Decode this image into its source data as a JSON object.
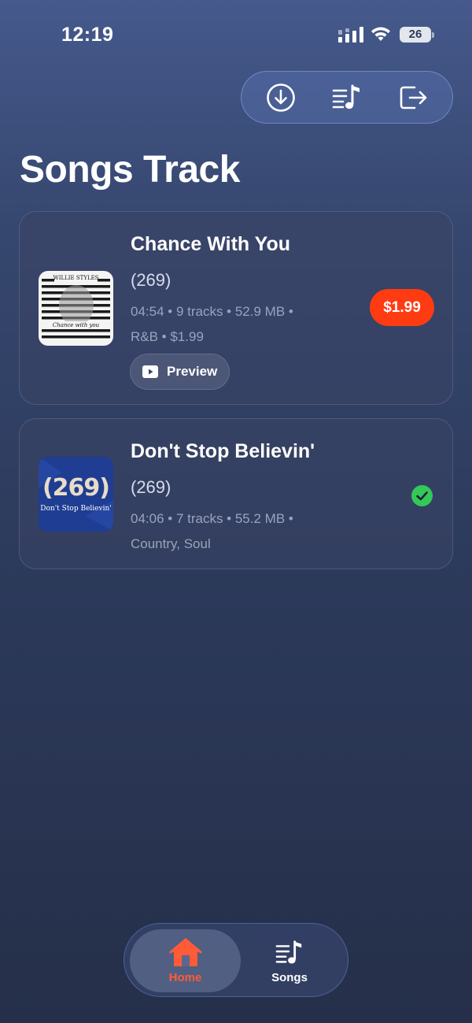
{
  "status_bar": {
    "time": "12:19",
    "battery": "26"
  },
  "top_actions": [
    {
      "icon": "download-icon"
    },
    {
      "icon": "playlist-icon"
    },
    {
      "icon": "logout-icon"
    }
  ],
  "page": {
    "title": "Songs Track"
  },
  "songs": [
    {
      "title": "Chance With You",
      "artist": "(269)",
      "meta_line1": "04:54 • 9 tracks • 52.9 MB •",
      "meta_line2": "R&B • $1.99",
      "cover_text_top": "WILLIE STYLES",
      "cover_text_bottom": "Chance with you",
      "preview_label": "Preview",
      "price": "$1.99"
    },
    {
      "title": "Don't Stop Believin'",
      "artist": "(269)",
      "meta_line1": "04:06 • 7 tracks • 55.2 MB •",
      "meta_line2": "Country, Soul",
      "cover_text_top": "(269)",
      "cover_text_bottom": "Don't Stop Believin'",
      "status": "purchased"
    }
  ],
  "tab_bar": {
    "home_label": "Home",
    "songs_label": "Songs"
  },
  "colors": {
    "accent_price": "#ff3b12",
    "tab_active": "#ff5b38",
    "check_green": "#34c759"
  }
}
